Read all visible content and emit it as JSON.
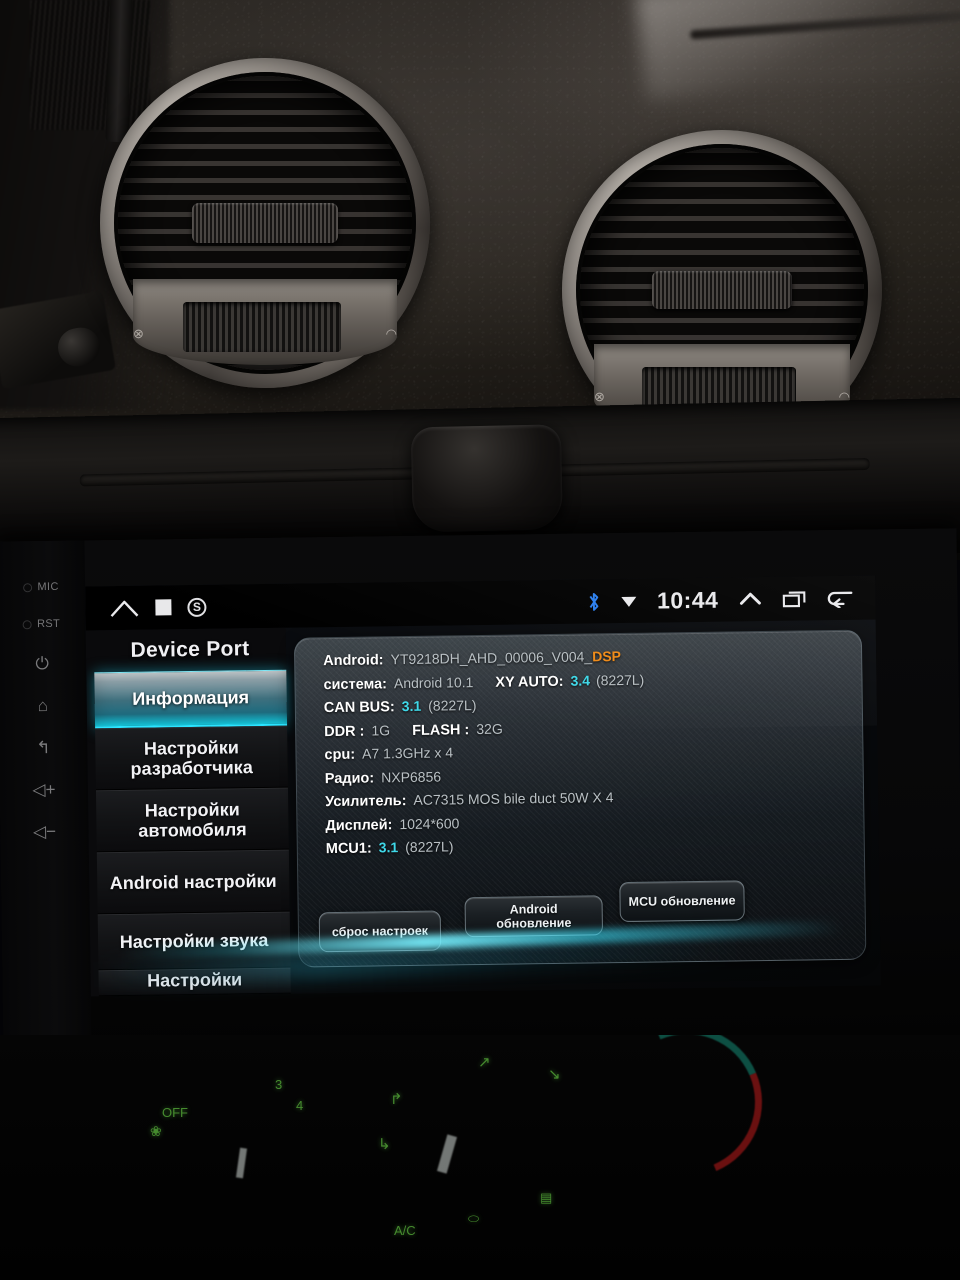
{
  "device": {
    "bezel_buttons": [
      {
        "name": "mic",
        "label": "MIC",
        "type": "hole"
      },
      {
        "name": "reset",
        "label": "RST",
        "type": "hole"
      },
      {
        "name": "power",
        "label": "⏻",
        "type": "icon"
      },
      {
        "name": "home",
        "label": "⌂",
        "type": "icon"
      },
      {
        "name": "back",
        "label": "↰",
        "type": "icon"
      },
      {
        "name": "volume-up",
        "label": "◁+",
        "type": "icon"
      },
      {
        "name": "volume-down",
        "label": "◁−",
        "type": "icon"
      }
    ]
  },
  "statusbar": {
    "left_icons": [
      {
        "name": "home-icon",
        "glyph": "⌂"
      },
      {
        "name": "stop-square-icon",
        "glyph": "■"
      },
      {
        "name": "shazam-icon",
        "glyph": "S"
      }
    ],
    "bluetooth_icon": "",
    "wifi_icon": "▼",
    "clock": "10:44",
    "right_icons": [
      {
        "name": "chevron-up-icon",
        "glyph": "⌃"
      },
      {
        "name": "recents-icon",
        "glyph": "❐"
      },
      {
        "name": "back-icon",
        "glyph": "↩"
      }
    ]
  },
  "sidebar": {
    "title": "Device Port",
    "items": [
      {
        "label": "Информация",
        "selected": true
      },
      {
        "label": "Настройки разработчика",
        "selected": false
      },
      {
        "label": "Настройки автомобиля",
        "selected": false
      },
      {
        "label": "Android настройки",
        "selected": false
      },
      {
        "label": "Настройки звука",
        "selected": false
      },
      {
        "label": "Настройки",
        "selected": false
      }
    ]
  },
  "info": {
    "rows": [
      {
        "label": "Android:",
        "value": "YT9218DH_AHD_00006_V004_",
        "suffix": "DSP",
        "suffix_color": "#ef8a17"
      },
      {
        "label": "система:",
        "value": "Android 10.1",
        "label2": "XY AUTO:",
        "value2": "3.4",
        "value2_color": "#3fd8e8",
        "extra2": "(8227L)"
      },
      {
        "label": "CAN BUS:",
        "value": "3.1",
        "value_color": "#3fd8e8",
        "extra": "(8227L)"
      },
      {
        "label": "DDR :",
        "value": "1G",
        "label2": "FLASH :",
        "value2": "32G"
      },
      {
        "label": "cpu:",
        "value": "A7 1.3GHz x 4"
      },
      {
        "label": "Радио:",
        "value": "NXP6856"
      },
      {
        "label": "Усилитель:",
        "value": "AC7315 MOS bile duct 50W X 4"
      },
      {
        "label": "Дисплей:",
        "value": "1024*600"
      },
      {
        "label": "MCU1:",
        "value": "3.1",
        "value_color": "#3fd8e8",
        "extra": "(8227L)"
      }
    ]
  },
  "buttons": {
    "reset": "сброс настроек",
    "android_update": "Android обновление",
    "mcu_update": "MCU обновление"
  },
  "climate": {
    "markings": [
      "OFF",
      "3",
      "4",
      "A/C"
    ]
  },
  "colors": {
    "accent_cyan": "#3fd8e8",
    "accent_orange": "#ef8a17",
    "selected_gradient_bottom": "#1ad8ef",
    "bluetooth_blue": "#2a7ff0",
    "hazard_red": "#b32020",
    "climate_green": "#5fbf3f"
  }
}
